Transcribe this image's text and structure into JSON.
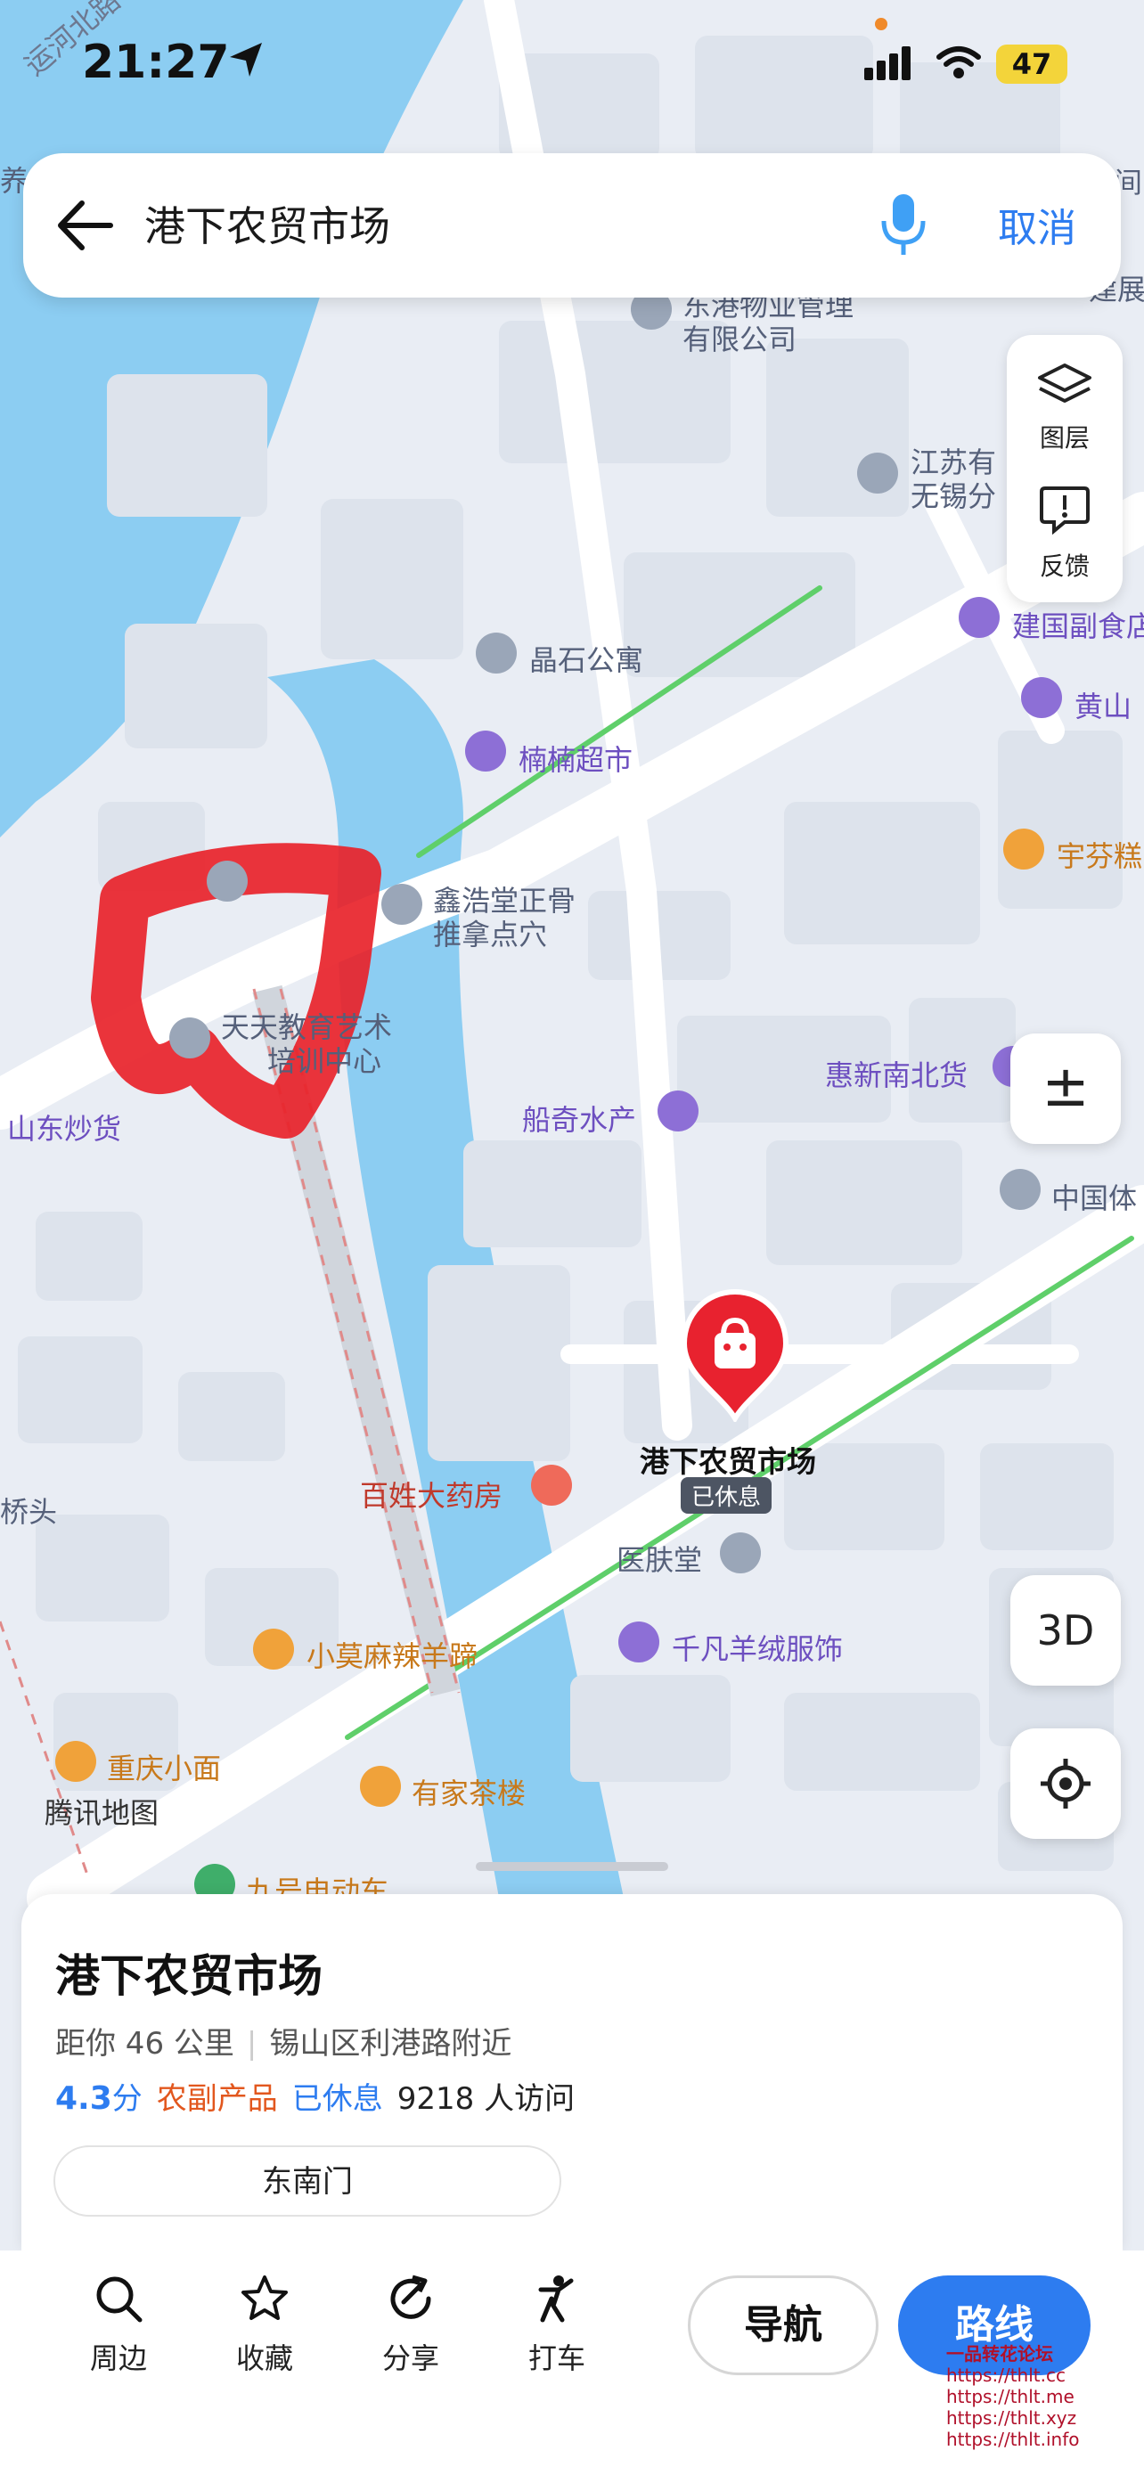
{
  "status_bar": {
    "time": "21:27",
    "battery": "47"
  },
  "search": {
    "query": "港下农贸市场",
    "cancel_label": "取消"
  },
  "map_tools": {
    "layers_label": "图层",
    "feedback_label": "反馈",
    "zoom_label": "±",
    "three_d_label": "3D"
  },
  "map": {
    "water_color": "#8ccdf2",
    "road_green": "#5fcf6a",
    "marker_color": "#e8222f",
    "labels": {
      "road_yunhe": "运河北路",
      "dongang": "东港物业管理",
      "dongang2": "有限公司",
      "jiangsu1": "江苏有",
      "jiangsu2": "无锡分",
      "jianguo": "建国副食店",
      "jingshi": "晶石公寓",
      "huangshan": "黄山",
      "nannan": "楠楠超市",
      "yufen": "宇芬糕",
      "xinhao1": "鑫浩堂正骨",
      "xinhao2": "推拿点穴",
      "tiantian1": "天天教育艺术",
      "tiantian2": "培训中心",
      "shandong": "山东炒货",
      "huixin": "惠新南北货",
      "chuanqi": "船奇水产",
      "zhongguo": "中国体",
      "qiaotou": "桥头",
      "baixing": "百姓大药房",
      "market": "港下农贸市场",
      "market_status": "已休息",
      "yifutang": "医肤堂",
      "qianfan": "千凡羊绒服饰",
      "xiaomo": "小莫麻辣羊蹄",
      "chongqing": "重庆小面",
      "tencent": "腾讯地图",
      "youjia": "有家茶楼",
      "jiuhao": "九号电动车",
      "yang_edge": "养",
      "top_right_edge1": "间",
      "top_right_edge2": "建展"
    }
  },
  "place": {
    "name": "港下农贸市场",
    "distance": "距你 46 公里",
    "address": "锡山区利港路附近",
    "rating_value": "4.3",
    "rating_unit": "分",
    "category": "农副产品",
    "status": "已休息",
    "visits": "9218 人访问",
    "gate_label": "东南门"
  },
  "bottom_bar": {
    "nearby": "周边",
    "favorite": "收藏",
    "share": "分享",
    "taxi": "打车",
    "navigate": "导航",
    "route": "路线"
  },
  "watermark": {
    "line1": "一品转花论坛",
    "line2": "https://thlt.cc",
    "line3": "https://thlt.me",
    "line4": "https://thlt.xyz",
    "line5": "https://thlt.info"
  }
}
